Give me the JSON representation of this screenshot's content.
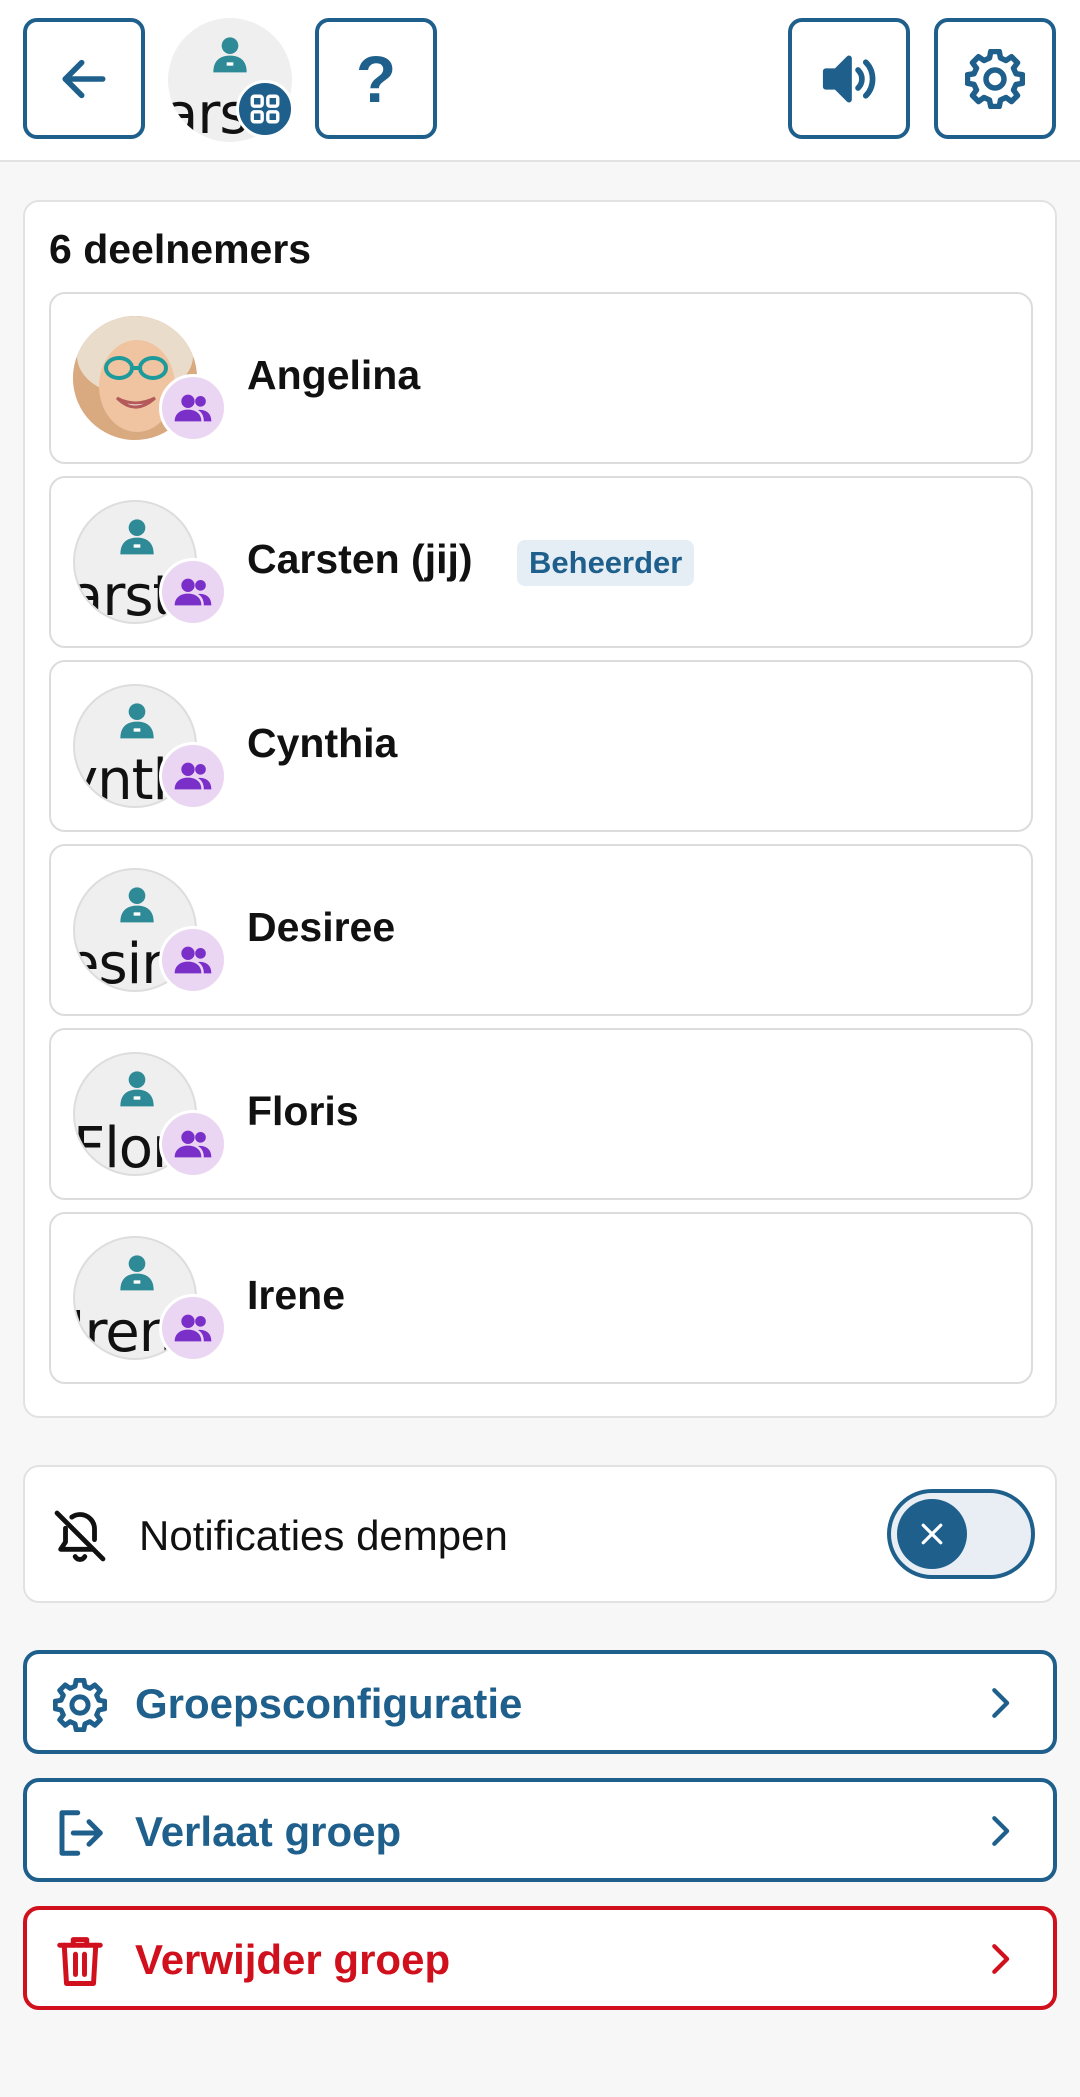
{
  "header": {
    "group_avatar_text": "arst",
    "icons": {
      "back": "arrow-left-icon",
      "help": "question-mark-icon",
      "sound": "speaker-icon",
      "settings": "gear-icon",
      "group_badge": "grid-icon"
    },
    "help_glyph": "?"
  },
  "participants": {
    "title": "6 deelnemers",
    "members": [
      {
        "name": "Angelina",
        "avatar": "photo",
        "avatar_text": ""
      },
      {
        "name": "Carsten (jij)",
        "avatar": "placeholder",
        "avatar_text": "arst",
        "role": "Beheerder"
      },
      {
        "name": "Cynthia",
        "avatar": "placeholder",
        "avatar_text": "ynth"
      },
      {
        "name": "Desiree",
        "avatar": "placeholder",
        "avatar_text": "esir"
      },
      {
        "name": "Floris",
        "avatar": "placeholder",
        "avatar_text": "Flor"
      },
      {
        "name": "Irene",
        "avatar": "placeholder",
        "avatar_text": "Iren"
      }
    ]
  },
  "mute": {
    "label": "Notificaties dempen",
    "icon": "bell-off-icon",
    "enabled": false
  },
  "actions": [
    {
      "label": "Groepsconfiguratie",
      "icon": "gear-icon",
      "variant": "primary"
    },
    {
      "label": "Verlaat groep",
      "icon": "exit-icon",
      "variant": "primary"
    },
    {
      "label": "Verwijder groep",
      "icon": "trash-icon",
      "variant": "danger"
    }
  ],
  "colors": {
    "primary": "#1e5f8c",
    "danger": "#d0101c",
    "group_badge_bg": "#ead6f2",
    "group_badge_icon": "#7b2fc9",
    "person_icon": "#2e8a96"
  }
}
